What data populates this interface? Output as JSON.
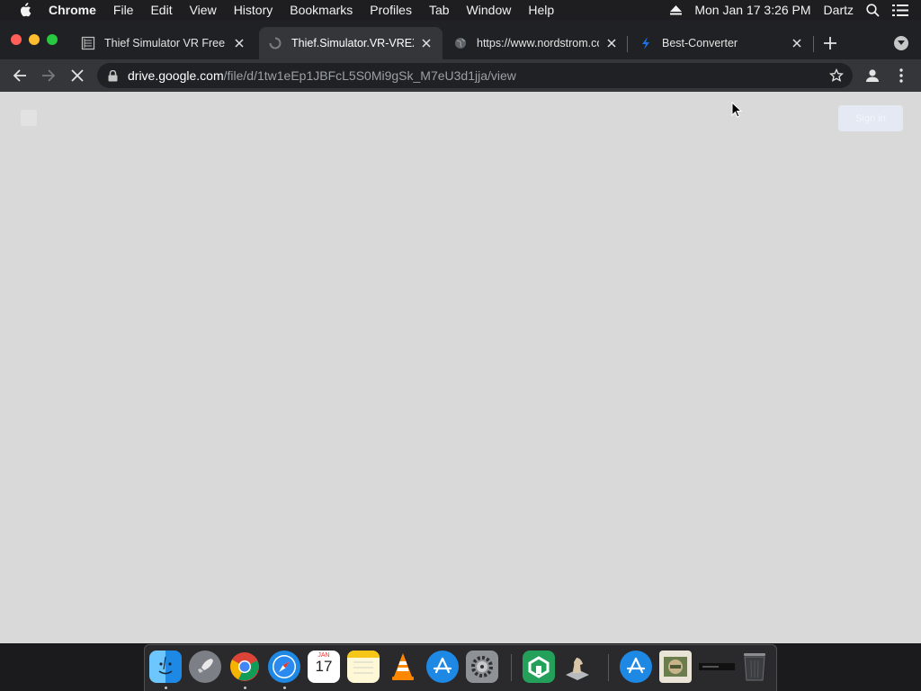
{
  "menubar": {
    "app_name": "Chrome",
    "items": [
      "File",
      "Edit",
      "View",
      "History",
      "Bookmarks",
      "Profiles",
      "Tab",
      "Window",
      "Help"
    ],
    "clock": "Mon Jan 17  3:26 PM",
    "user": "Dartz"
  },
  "tabs": [
    {
      "title": "Thief Simulator VR Free Do",
      "favicon": "document-icon",
      "active": false
    },
    {
      "title": "Thief.Simulator.VR-VREX.ra",
      "favicon": "loading-icon",
      "active": true
    },
    {
      "title": "https://www.nordstrom.com",
      "favicon": "globe-icon",
      "active": false
    },
    {
      "title": "Best-Converter",
      "favicon": "converter-icon",
      "active": false
    }
  ],
  "toolbar": {
    "url_domain": "drive.google.com",
    "url_path": "/file/d/1tw1eEp1JBFcL5S0Mi9gSk_M7eU3d1jja/view"
  },
  "page": {
    "signin_label": "Sign in"
  },
  "dock": {
    "apps": [
      "Finder",
      "Launchpad",
      "Google Chrome",
      "Safari",
      "Calendar",
      "Notes",
      "VLC",
      "App Store",
      "System Preferences",
      "Linkage",
      "Chess",
      "App Store Folder",
      "Photo",
      "Screen",
      "Trash"
    ],
    "calendar_month": "JAN",
    "calendar_day": "17"
  },
  "colors": {
    "page_background": "#d9d9d9",
    "tabstrip": "#202124",
    "toolbar": "#35363a",
    "signin_button": "#e4e9f4"
  }
}
